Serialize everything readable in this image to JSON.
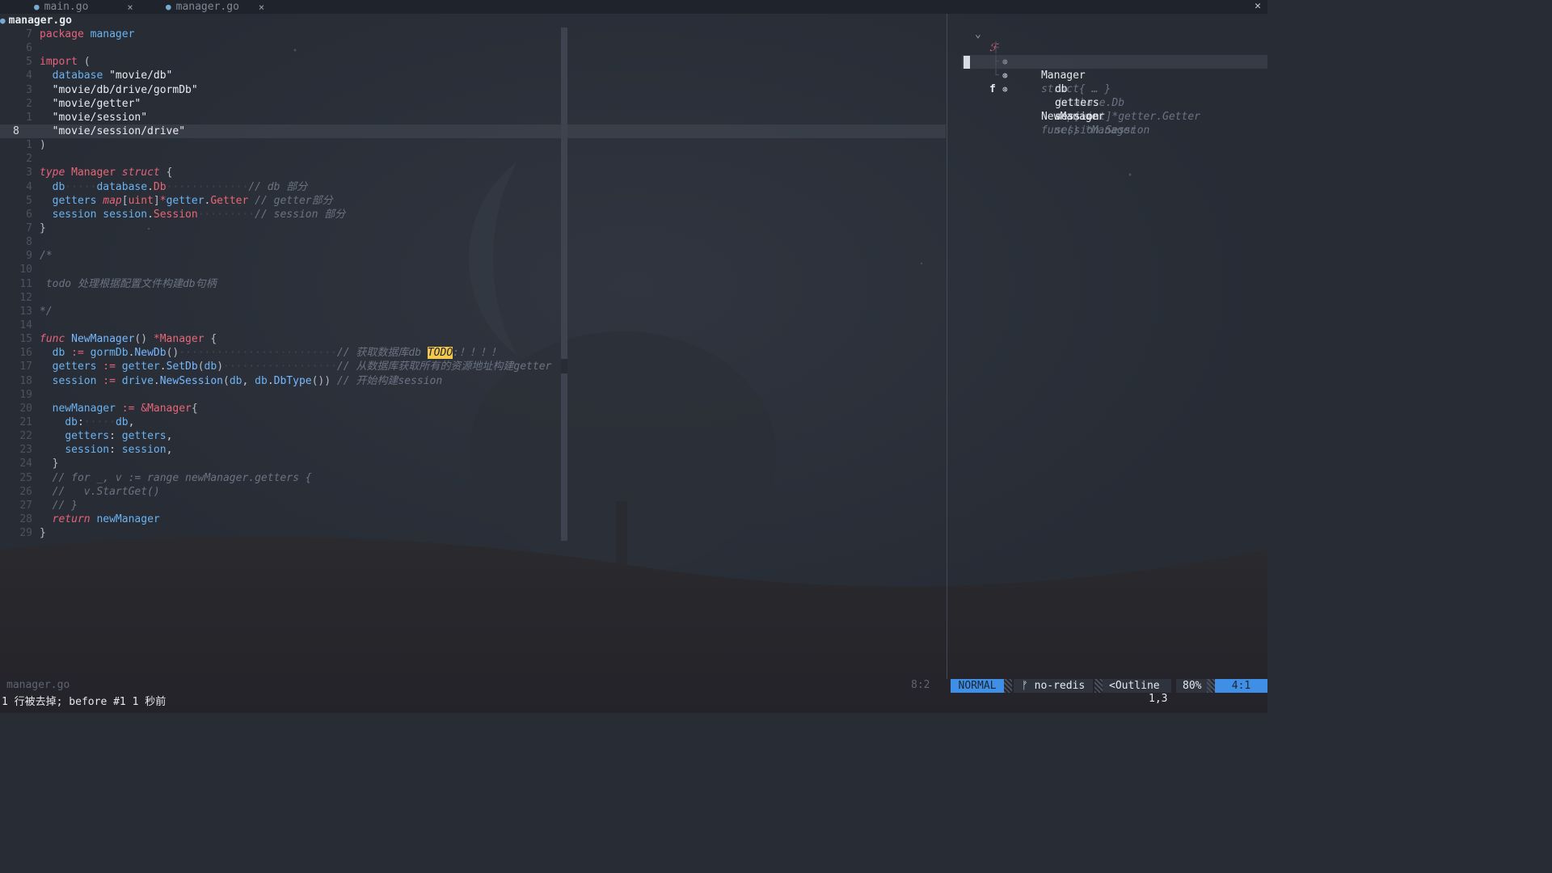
{
  "tabs": [
    {
      "label": "main.go",
      "active": false
    },
    {
      "label": "manager.go",
      "active": true
    }
  ],
  "tab_close_glyph": "×",
  "close_all_glyph": "✕",
  "winbar": {
    "file": "manager.go"
  },
  "code_lines": [
    {
      "num": "7",
      "cur": false,
      "html": "<span class='kw2'>package</span> <span class='id'>manager</span>"
    },
    {
      "num": "6",
      "cur": false,
      "html": ""
    },
    {
      "num": "5",
      "cur": false,
      "html": "<span class='kw2'>import</span> <span class='punc'>(</span>"
    },
    {
      "num": "4",
      "cur": false,
      "html": "  <span class='id'>database</span> <span class='str'>\"movie/db\"</span>"
    },
    {
      "num": "3",
      "cur": false,
      "html": "  <span class='str'>\"movie/db/drive/gormDb\"</span>"
    },
    {
      "num": "2",
      "cur": false,
      "html": "  <span class='str'>\"movie/getter\"</span>"
    },
    {
      "num": "1",
      "cur": false,
      "html": "  <span class='str'>\"movie/session\"</span>"
    },
    {
      "num": "8",
      "cur": true,
      "html": "  <span class='str'>\"movie/session/drive\"</span>"
    },
    {
      "num": "1",
      "cur": false,
      "html": "<span class='punc'>)</span>"
    },
    {
      "num": "2",
      "cur": false,
      "html": ""
    },
    {
      "num": "3",
      "cur": false,
      "html": "<span class='kw'>type</span> <span class='typ'>Manager</span> <span class='kw'>struct</span> <span class='punc'>{</span>"
    },
    {
      "num": "4",
      "cur": false,
      "html": "  <span class='id'>db</span><span class='dot'>·····</span><span class='id'>database</span>.<span class='typ'>Db</span><span class='dot'>·············</span><span class='cm'>// db 部分</span>"
    },
    {
      "num": "5",
      "cur": false,
      "html": "  <span class='id'>getters</span> <span class='kw'>map</span><span class='punc'>[</span><span class='typ'>uint</span><span class='punc'>]</span><span class='op'>*</span><span class='id'>getter</span>.<span class='typ'>Getter</span> <span class='cm'>// getter部分</span>"
    },
    {
      "num": "6",
      "cur": false,
      "html": "  <span class='id'>session</span> <span class='id'>session</span>.<span class='typ'>Session</span><span class='dot'>·········</span><span class='cm'>// session 部分</span>"
    },
    {
      "num": "7",
      "cur": false,
      "html": "<span class='punc'>}</span>"
    },
    {
      "num": "8",
      "cur": false,
      "html": ""
    },
    {
      "num": "9",
      "cur": false,
      "html": "<span class='cm'>/*</span>"
    },
    {
      "num": "10",
      "cur": false,
      "html": ""
    },
    {
      "num": "11",
      "cur": false,
      "html": " <span class='cm'>todo 处理根据配置文件构建db句柄</span>"
    },
    {
      "num": "12",
      "cur": false,
      "html": ""
    },
    {
      "num": "13",
      "cur": false,
      "html": "<span class='cm'>*/</span>"
    },
    {
      "num": "14",
      "cur": false,
      "html": ""
    },
    {
      "num": "15",
      "cur": false,
      "html": "<span class='kw'>func</span> <span class='fn'>NewManager</span><span class='punc'>()</span> <span class='op'>*</span><span class='typ'>Manager</span> <span class='punc'>{</span>"
    },
    {
      "num": "16",
      "cur": false,
      "html": "  <span class='id'>db</span> <span class='op'>:=</span> <span class='id'>gormDb</span>.<span class='fn'>NewDb</span><span class='punc'>()</span><span class='dot'>·························</span><span class='cm'>// 获取数据库db </span><span class='todo'>TODO</span><span class='cm'>:！！！！</span>"
    },
    {
      "num": "17",
      "cur": false,
      "html": "  <span class='id'>getters</span> <span class='op'>:=</span> <span class='id'>getter</span>.<span class='fn'>SetDb</span><span class='punc'>(</span><span class='id'>db</span><span class='punc'>)</span><span class='dot'>··················</span><span class='cm'>// 从数据库获取所有的资源地址构建getter</span>"
    },
    {
      "num": "18",
      "cur": false,
      "html": "  <span class='id'>session</span> <span class='op'>:=</span> <span class='id'>drive</span>.<span class='fn'>NewSession</span><span class='punc'>(</span><span class='id'>db</span>, <span class='id'>db</span>.<span class='fn'>DbType</span><span class='punc'>())</span> <span class='cm'>// 开始构建session</span>"
    },
    {
      "num": "19",
      "cur": false,
      "html": ""
    },
    {
      "num": "20",
      "cur": false,
      "html": "  <span class='id'>newManager</span> <span class='op'>:=</span> <span class='op'>&amp;</span><span class='typ'>Manager</span><span class='punc'>{</span>"
    },
    {
      "num": "21",
      "cur": false,
      "html": "    <span class='id'>db</span>:<span class='dot'>·····</span><span class='id'>db</span>,"
    },
    {
      "num": "22",
      "cur": false,
      "html": "    <span class='id'>getters</span>: <span class='id'>getters</span>,"
    },
    {
      "num": "23",
      "cur": false,
      "html": "    <span class='id'>session</span>: <span class='id'>session</span>,"
    },
    {
      "num": "24",
      "cur": false,
      "html": "  <span class='punc'>}</span>"
    },
    {
      "num": "25",
      "cur": false,
      "html": "  <span class='cm'>// for _, v := range newManager.getters {</span>"
    },
    {
      "num": "26",
      "cur": false,
      "html": "  <span class='cm'>//   v.StartGet()</span>"
    },
    {
      "num": "27",
      "cur": false,
      "html": "  <span class='cm'>// }</span>"
    },
    {
      "num": "28",
      "cur": false,
      "html": "  <span class='kw'>return</span> <span class='id'>newManager</span>"
    },
    {
      "num": "29",
      "cur": false,
      "html": "<span class='punc'>}</span>"
    }
  ],
  "outline": {
    "root": {
      "chevron": "⌄",
      "icon": "ℱ",
      "name": "Manager",
      "detail": "struct{ … }"
    },
    "fields": [
      {
        "tree": "├",
        "icon": "⊛",
        "name": "db",
        "detail": "database.Db",
        "selected": false
      },
      {
        "tree": "├",
        "icon": "⊛",
        "name": "getters",
        "detail": "map[uint]*getter.Getter",
        "selected": false
      },
      {
        "tree": "└",
        "icon": "⊛",
        "name": "session",
        "detail": "session.Session",
        "selected": true
      }
    ],
    "func": {
      "icon": "f",
      "name": "NewManager",
      "detail": "func() *Manager"
    }
  },
  "status": {
    "file": "manager.go",
    "pos": "8:2",
    "mode": "NORMAL",
    "branch": "ᚠ no-redis",
    "filetype": "<Outline",
    "percent": "80%",
    "location": "4:1"
  },
  "cmdline": {
    "message": "1 行被去掉; before #1  1 秒前",
    "ruler": "1,3"
  }
}
